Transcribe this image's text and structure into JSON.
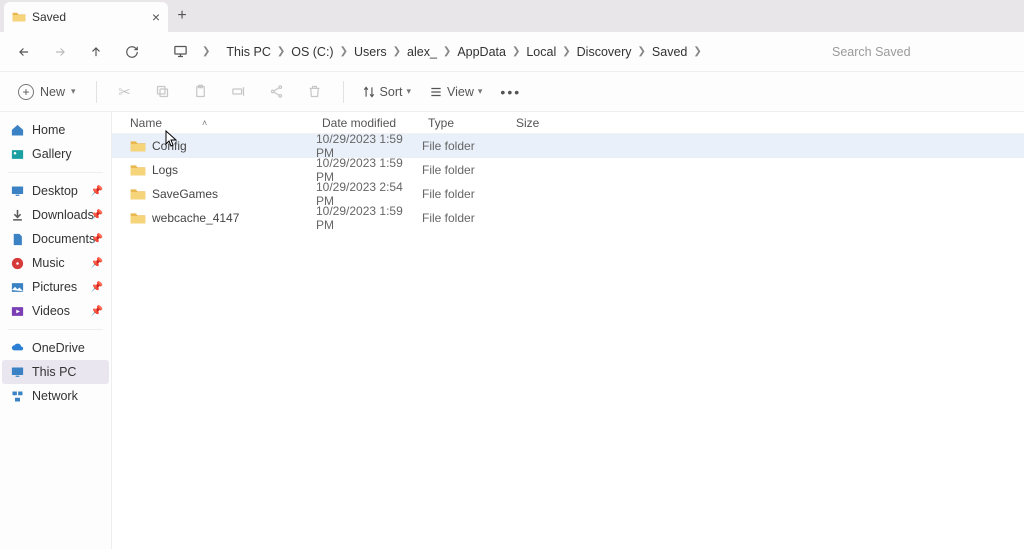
{
  "tab": {
    "title": "Saved"
  },
  "breadcrumbs": [
    "This PC",
    "OS (C:)",
    "Users",
    "alex_",
    "AppData",
    "Local",
    "Discovery",
    "Saved"
  ],
  "search": {
    "placeholder": "Search Saved"
  },
  "toolbar": {
    "new": "New",
    "sort": "Sort",
    "view": "View"
  },
  "columns": {
    "name": "Name",
    "date": "Date modified",
    "type": "Type",
    "size": "Size"
  },
  "sidebar": {
    "top": [
      {
        "label": "Home",
        "icon": "home"
      },
      {
        "label": "Gallery",
        "icon": "gallery"
      }
    ],
    "pinned": [
      {
        "label": "Desktop",
        "icon": "desktop"
      },
      {
        "label": "Downloads",
        "icon": "downloads"
      },
      {
        "label": "Documents",
        "icon": "documents"
      },
      {
        "label": "Music",
        "icon": "music"
      },
      {
        "label": "Pictures",
        "icon": "pictures"
      },
      {
        "label": "Videos",
        "icon": "videos"
      }
    ],
    "bottom": [
      {
        "label": "OneDrive",
        "icon": "onedrive"
      },
      {
        "label": "This PC",
        "icon": "thispc",
        "selected": true
      },
      {
        "label": "Network",
        "icon": "network"
      }
    ]
  },
  "rows": [
    {
      "name": "Config",
      "date": "10/29/2023 1:59 PM",
      "type": "File folder",
      "highlight": true
    },
    {
      "name": "Logs",
      "date": "10/29/2023 1:59 PM",
      "type": "File folder"
    },
    {
      "name": "SaveGames",
      "date": "10/29/2023 2:54 PM",
      "type": "File folder"
    },
    {
      "name": "webcache_4147",
      "date": "10/29/2023 1:59 PM",
      "type": "File folder"
    }
  ]
}
